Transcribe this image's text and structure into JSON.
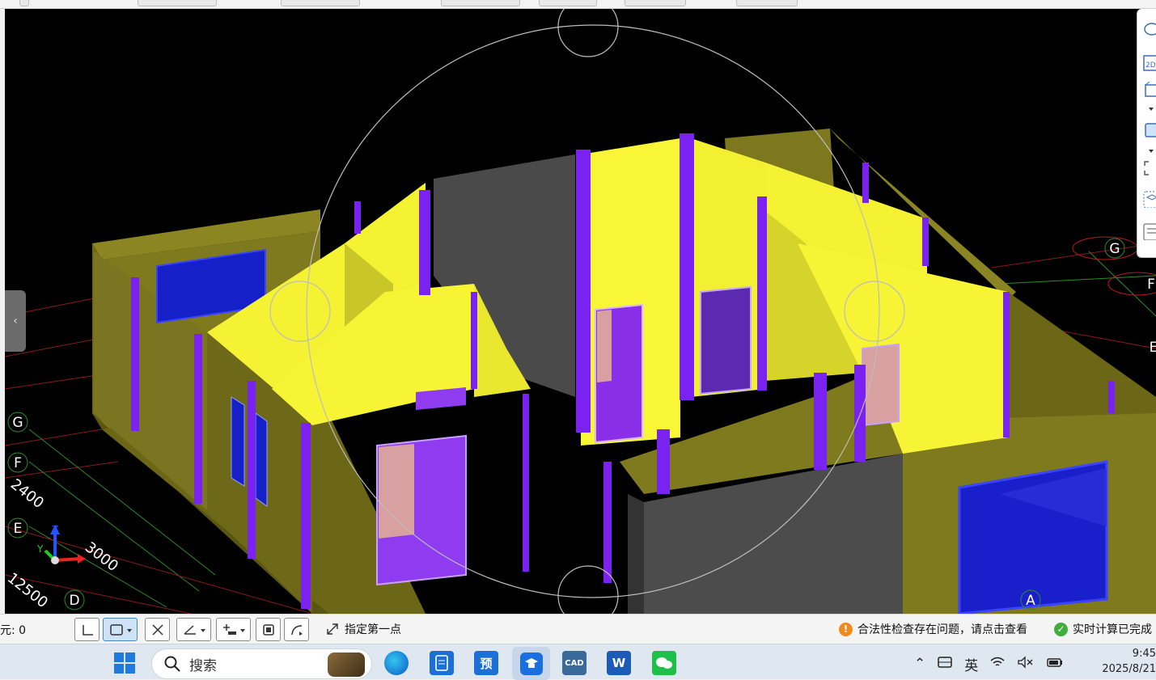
{
  "viewport": {
    "axis_labels_left": [
      "G",
      "F",
      "E",
      "D"
    ],
    "axis_labels_right": [
      "G",
      "F",
      "E"
    ],
    "axis_label_bottom": "A",
    "dimension_labels": [
      "2400",
      "3000",
      "12500"
    ],
    "gizmo_axes": {
      "z": "Z",
      "y": "Y"
    }
  },
  "right_toolbar": {
    "icons": [
      "orbit-icon",
      "view-2d-icon",
      "view-3d-icon",
      "dropdown-icon",
      "box-view-icon",
      "dropdown-icon",
      "select-frame-icon",
      "isometric-cube-icon",
      "list-icon"
    ],
    "view_2d_label": "2D"
  },
  "statusbar": {
    "selection_label": "元: 0",
    "prompt": "指定第一点",
    "warning_text": "合法性检查存在问题，请点击查看",
    "calc_text": "实时计算已完成"
  },
  "taskbar": {
    "search_placeholder": "搜索",
    "apps": [
      {
        "name": "edge",
        "label": ""
      },
      {
        "name": "app-doc",
        "label": ""
      },
      {
        "name": "yu-app",
        "label": "预"
      },
      {
        "name": "tencent-app",
        "label": ""
      },
      {
        "name": "cad-app",
        "label": "CAD"
      },
      {
        "name": "word-app",
        "label": "W"
      },
      {
        "name": "wechat-app",
        "label": ""
      }
    ],
    "tray_input_lang": "英",
    "time": "9:45",
    "date": "2025/8/21"
  },
  "colors": {
    "wall_yellow": "#f4f232",
    "wall_olive": "#7f7a1d",
    "column_purple": "#7a22f0",
    "window_blue": "#1620c8",
    "door_pink": "#d8a0a0",
    "gray_wall": "#4a4a4a",
    "grid_red": "#8a1a1a",
    "grid_green": "#2e8a2e"
  }
}
